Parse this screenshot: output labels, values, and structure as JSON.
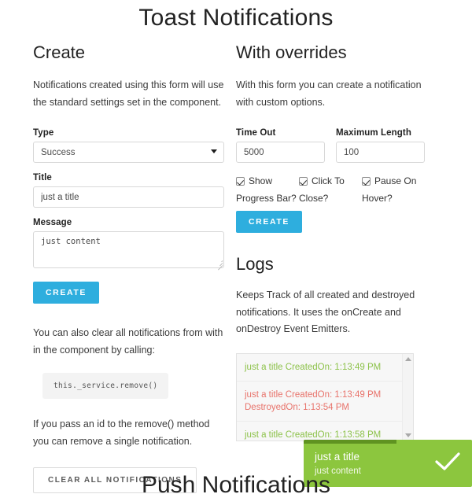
{
  "page": {
    "title": "Toast Notifications",
    "bottom_title": "Push Notifications",
    "accent_blue": "#2eaede",
    "success_green": "#8cc63e",
    "error_red": "#e8736b"
  },
  "create": {
    "heading": "Create",
    "description": "Notifications created using this form will use the standard settings set in the component.",
    "type_label": "Type",
    "type_value": "Success",
    "title_label": "Title",
    "title_value": "just a title",
    "message_label": "Message",
    "message_value": "just content",
    "create_button": "CREATE",
    "clear_note": "You can also clear all notifications from with in the component by calling:",
    "code_snippet": "this._service.remove()",
    "remove_note": "If you pass an id to the remove() method you can remove a single notification.",
    "clear_button": "CLEAR ALL NOTIFICATIONS"
  },
  "overrides": {
    "heading": "With overrides",
    "description": "With this form you can create a notification with custom options.",
    "timeout_label": "Time Out",
    "timeout_value": "5000",
    "maxlength_label": "Maximum Length",
    "maxlength_value": "100",
    "checkboxes": [
      {
        "line1": "Show",
        "line2": "Progress Bar?",
        "checked": true
      },
      {
        "line1": "Click To",
        "line2": "Close?",
        "checked": true
      },
      {
        "line1": "Pause On",
        "line2": "Hover?",
        "checked": true
      }
    ],
    "create_button": "CREATE"
  },
  "logs": {
    "heading": "Logs",
    "description": "Keeps Track of all created and destroyed notifications. It uses the onCreate and onDestroy Event Emitters.",
    "entries": [
      {
        "text": "just a title CreatedOn: 1:13:49 PM",
        "kind": "created"
      },
      {
        "text": "just a title CreatedOn: 1:13:49 PM DestroyedOn: 1:13:54 PM",
        "kind": "destroyed"
      },
      {
        "text": "just a title CreatedOn: 1:13:58 PM",
        "kind": "created"
      }
    ]
  },
  "toast": {
    "title": "just a title",
    "message": "just content",
    "icon": "check-icon",
    "progress_percent": 55
  }
}
